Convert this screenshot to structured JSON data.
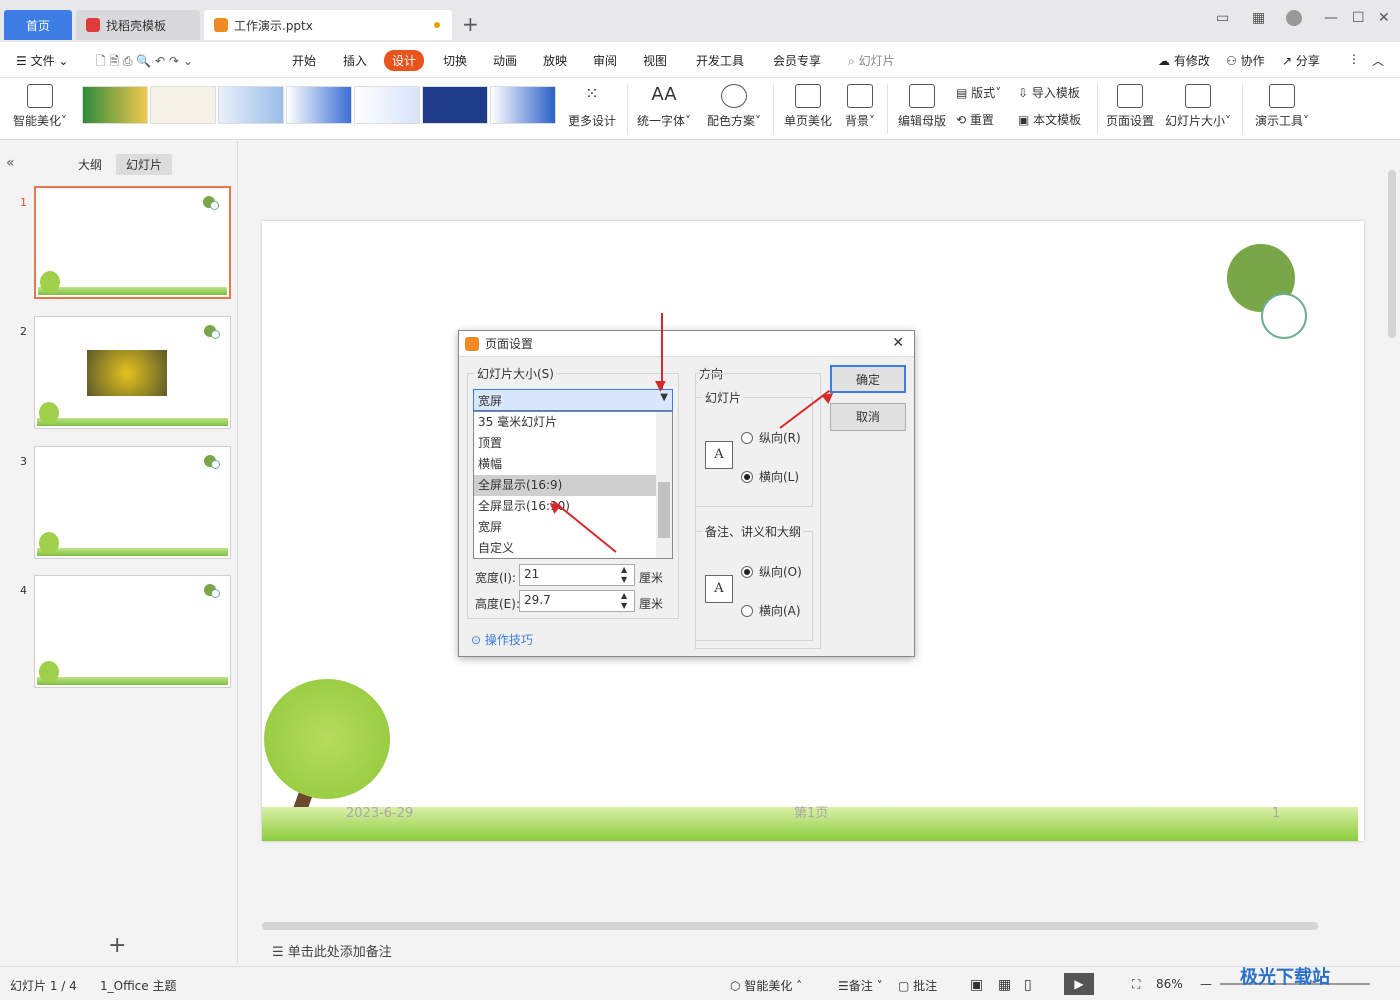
{
  "tabs": {
    "home": "首页",
    "find": "找稻壳模板",
    "doc": "工作演示.pptx"
  },
  "menu": {
    "file": "文件",
    "items": [
      "开始",
      "插入",
      "设计",
      "切换",
      "动画",
      "放映",
      "审阅",
      "视图",
      "开发工具",
      "会员专享"
    ],
    "search": "幻灯片",
    "right": [
      "有修改",
      "协作",
      "分享"
    ]
  },
  "ribbon": {
    "smart": "智能美化",
    "more": "更多设计",
    "font": "统一字体",
    "color": "配色方案",
    "single": "单页美化",
    "bg": "背景",
    "edit_master": "编辑母版",
    "layout": "版式",
    "reset": "重置",
    "import": "导入模板",
    "text_tpl": "本文模板",
    "page_setup": "页面设置",
    "slide_size": "幻灯片大小",
    "tools": "演示工具"
  },
  "panel": {
    "outline": "大纲",
    "slides": "幻灯片",
    "nums": [
      "1",
      "2",
      "3",
      "4"
    ]
  },
  "slide": {
    "date": "2023-6-29",
    "page": "第1页",
    "num": "1"
  },
  "dialog": {
    "title": "页面设置",
    "size_label": "幻灯片大小(S)",
    "selected": "宽屏",
    "options": [
      "35 毫米幻灯片",
      "顶置",
      "横幅",
      "全屏显示(16:9)",
      "全屏显示(16:10)",
      "宽屏",
      "自定义"
    ],
    "width_label": "宽度(I):",
    "width_val": "21",
    "height_label": "高度(E):",
    "height_val": "29.7",
    "unit": "厘米",
    "tips": "操作技巧",
    "orient": "方向",
    "slide_grp": "幻灯片",
    "portrait": "纵向(R)",
    "landscape": "横向(L)",
    "notes_grp": "备注、讲义和大纲",
    "n_portrait": "纵向(O)",
    "n_landscape": "横向(A)",
    "ok": "确定",
    "cancel": "取消"
  },
  "notes": "单击此处添加备注",
  "status": {
    "slide": "幻灯片 1 / 4",
    "theme": "1_Office 主题",
    "smart": "智能美化",
    "notes": "备注",
    "comment": "批注",
    "zoom": "86%"
  },
  "watermark": "极光下载站",
  "colors": {
    "accent": "#e8541e",
    "brand": "#3b7de4"
  }
}
